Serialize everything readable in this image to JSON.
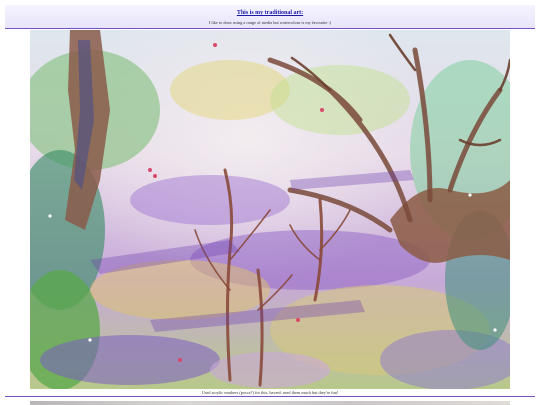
{
  "header": {
    "title": "This is my traditional art:",
    "subtitle": "I like to draw using a range of media but watercolour is my favourite :)"
  },
  "artwork": {
    "caption": "Used acrylic markers (posca?) for this, haven't used them much but they're fun!"
  },
  "colors": {
    "accent": "#7a52c8",
    "link": "#1a1aa8"
  }
}
